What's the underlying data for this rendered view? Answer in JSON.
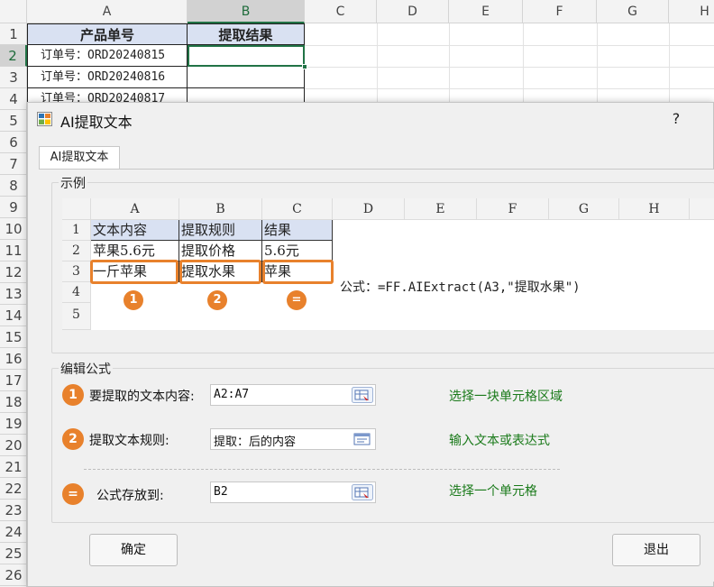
{
  "sheet": {
    "columns": [
      "A",
      "B",
      "C",
      "D",
      "E",
      "F",
      "G",
      "H"
    ],
    "rows": [
      "1",
      "2",
      "3",
      "4",
      "5",
      "6",
      "7",
      "8",
      "9",
      "10",
      "11",
      "12",
      "13",
      "14",
      "15",
      "16",
      "17",
      "18",
      "19",
      "20",
      "21",
      "22",
      "23",
      "24",
      "25",
      "26"
    ],
    "header_a": "产品单号",
    "header_b": "提取结果",
    "cells": [
      "订单号：ORD20240815",
      "订单号：ORD20240816",
      "订单号：ORD20240817"
    ]
  },
  "dialog": {
    "title": "AI提取文本",
    "help": "?",
    "tab": "AI提取文本",
    "example_group": "示例",
    "example": {
      "columns": [
        "A",
        "B",
        "C",
        "D",
        "E",
        "F",
        "G",
        "H"
      ],
      "rows": [
        "1",
        "2",
        "3",
        "4",
        "5"
      ],
      "header": [
        "文本内容",
        "提取规则",
        "结果"
      ],
      "row2": [
        "苹果5.6元",
        "提取价格",
        "5.6元"
      ],
      "row3": [
        "一斤苹果",
        "提取水果",
        "苹果"
      ],
      "badges": [
        "1",
        "2",
        "="
      ],
      "formula_note": "公式：=FF.AIExtract(A3,\"提取水果\")"
    },
    "edit_group": "编辑公式",
    "fields": [
      {
        "badge": "1",
        "label": "要提取的文本内容:",
        "value": "A2:A7",
        "hint": "选择一块单元格区域"
      },
      {
        "badge": "2",
        "label": "提取文本规则:",
        "value": "提取：后的内容",
        "hint": "输入文本或表达式"
      },
      {
        "badge": "=",
        "label": "公式存放到:",
        "value": "B2",
        "hint": "选择一个单元格"
      }
    ],
    "ok": "确定",
    "exit": "退出"
  },
  "colors": {
    "accent": "#e8812c",
    "excel_green": "#217346",
    "hint_green": "#1a7a1a",
    "header_blue": "#d9e1f2"
  }
}
